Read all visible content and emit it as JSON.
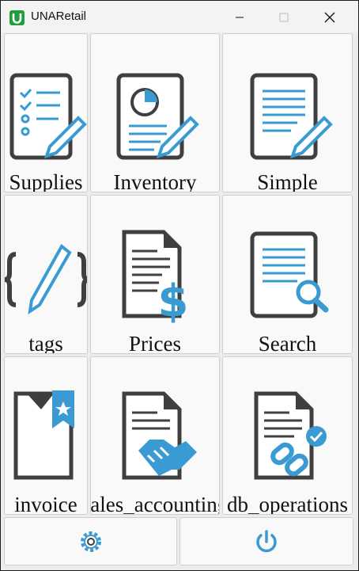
{
  "window": {
    "title": "UNARetail"
  },
  "tiles": [
    {
      "label": "Supplies",
      "icon": "clipboard-pencil-icon"
    },
    {
      "label": "Inventory",
      "icon": "report-chart-pencil-icon"
    },
    {
      "label": "Simple",
      "icon": "document-pencil-icon"
    },
    {
      "label": "tags",
      "icon": "braces-pencil-icon"
    },
    {
      "label": "Prices",
      "icon": "document-dollar-icon"
    },
    {
      "label": "Search",
      "icon": "document-search-icon"
    },
    {
      "label": "invoice",
      "icon": "document-bookmark-icon"
    },
    {
      "label": "sales_accounting",
      "icon": "document-handshake-icon"
    },
    {
      "label": "db_operations",
      "icon": "document-link-check-icon"
    }
  ],
  "toolbar": {
    "settings_icon": "gear-icon",
    "power_icon": "power-icon"
  },
  "colors": {
    "accent": "#3a9bd2",
    "dark": "#3f3f3f"
  }
}
